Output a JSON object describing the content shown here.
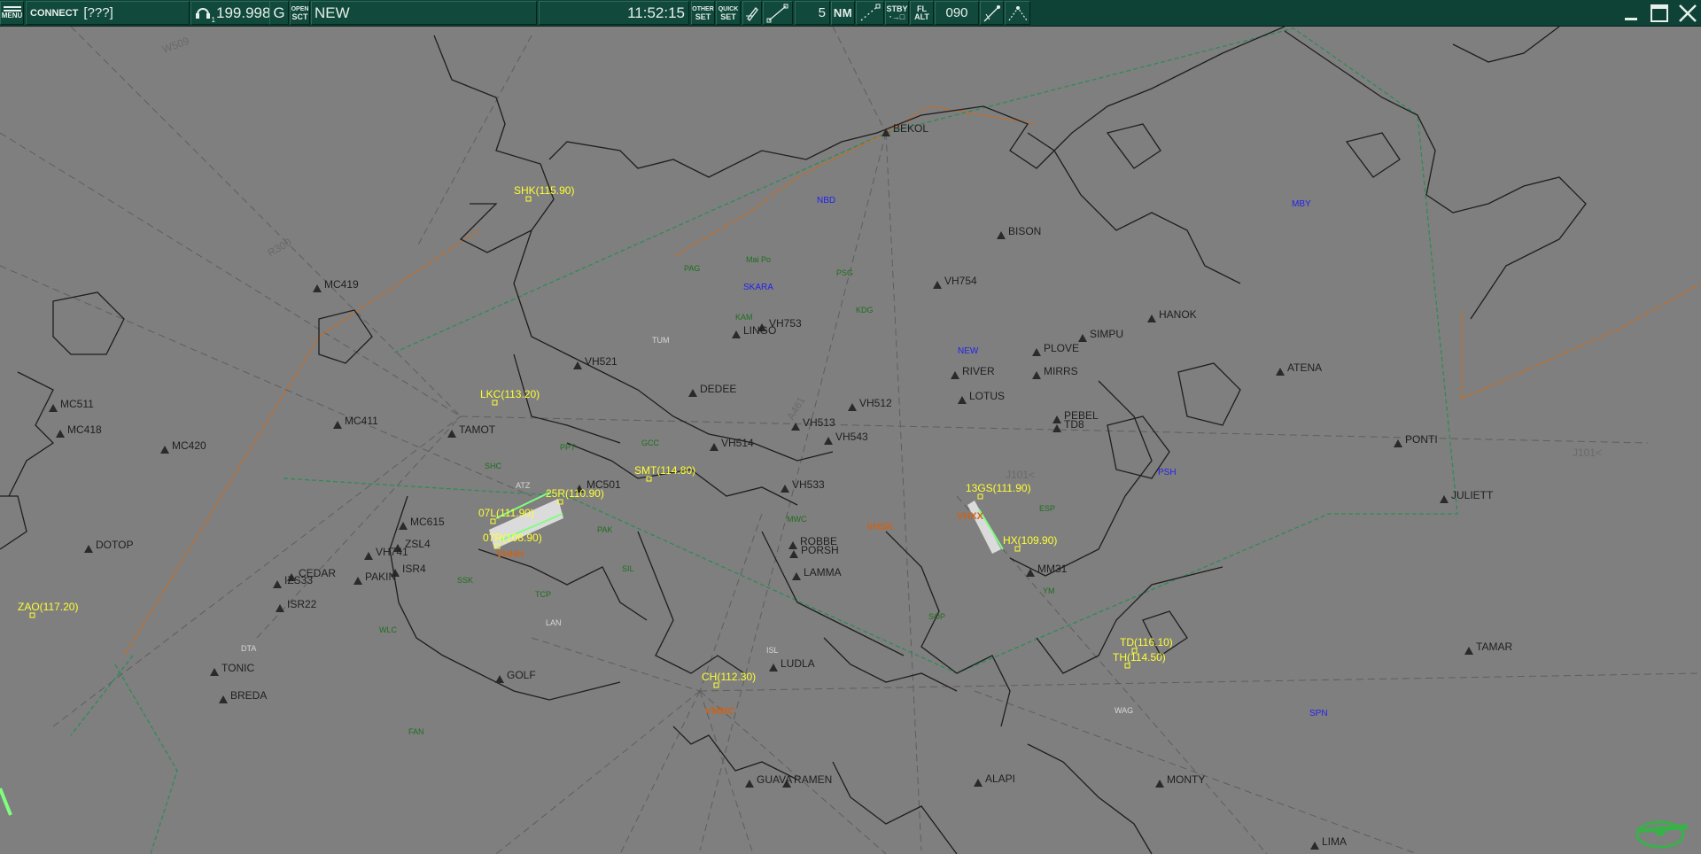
{
  "toolbar": {
    "menu_label": "MENU",
    "connect_label": "CONNECT",
    "callsign": "[???]",
    "headset_index": "1",
    "frequency": "199.998",
    "facility_letter": "G",
    "open_label": "OPEN",
    "sct_label": "SCT",
    "sector_name": "NEW",
    "clock": "11:52:15",
    "other_label": "OTHER",
    "set_label": "SET",
    "quick_label": "QUICK",
    "quick_set_label": "SET",
    "range_value": "5",
    "range_unit": "NM",
    "stby_label": "STBY",
    "fl_label": "FL",
    "alt_label": "ALT",
    "heading_value": "090"
  },
  "colors": {
    "background": "#7f7f7f",
    "coastline": "#1e1e1e",
    "fix_label": "#1f1f1f",
    "vor_label": "#ffff33",
    "airway": "#5e5e5e",
    "boundary_green": "#2e8b57",
    "boundary_orange": "#cc6b1a",
    "ndb_label": "#2222ee",
    "vfr_label": "#1e6e1e",
    "airport_label": "#c8641e",
    "runway": "#e6e6e6"
  },
  "map": {
    "fixes": [
      "BEKOL",
      "BISON",
      "VH754",
      "HANOK",
      "SIMPU",
      "PLOVE",
      "MIRRS",
      "RIVER",
      "LOTUS",
      "ATENA",
      "PEBEL",
      "TD8",
      "VH513",
      "VH512",
      "VH543",
      "VH521",
      "DEDEE",
      "LINGO",
      "VH753",
      "TAMOT",
      "MC419",
      "MC411",
      "MC420",
      "MC418",
      "MC511",
      "MC615",
      "VH741",
      "ISR4",
      "ZSL4",
      "CEDAR",
      "IZS33",
      "ISR22",
      "PAKIN",
      "DOTOP",
      "TONIC",
      "BREDA",
      "GOLF",
      "LUDLA",
      "ROBBE",
      "PORSH",
      "LAMMA",
      "VH533",
      "VH514",
      "PONTI",
      "JULIETT",
      "TAMAR",
      "MONTY",
      "ALAPI",
      "GUAVA",
      "RAMEN",
      "LIMA",
      "MM31",
      "MC501"
    ],
    "vors": [
      "SHK(115.90)",
      "LKC(113.20)",
      "SMT(114.80)",
      "25R(110.90)",
      "07L(111.90)",
      "07R(108.90)",
      "CH(112.30)",
      "13GS(111.90)",
      "HX(109.90)",
      "TD(116.10)",
      "TH(114.50)",
      "ZAO(117.20)"
    ],
    "ndbs": [
      "NBD",
      "MBY",
      "SKARA",
      "NEW",
      "PSH",
      "SPN"
    ],
    "vfr_points": [
      "PAG",
      "Mai Po",
      "PSG",
      "KAM",
      "KDG",
      "PPT",
      "GCC",
      "SHC",
      "PAK",
      "SIL",
      "TCP",
      "SSK",
      "WLC",
      "FAN",
      "MWC",
      "SOP",
      "ESP",
      "YM",
      "ATZ",
      "LAN",
      "DTA",
      "ISL",
      "WAG",
      "TUM"
    ],
    "airports": [
      "VHHH",
      "VMMC",
      "VHSK",
      "VHXX"
    ],
    "sectors": [
      "ATZ",
      "R300",
      "W509",
      "J101<",
      "A461"
    ]
  }
}
